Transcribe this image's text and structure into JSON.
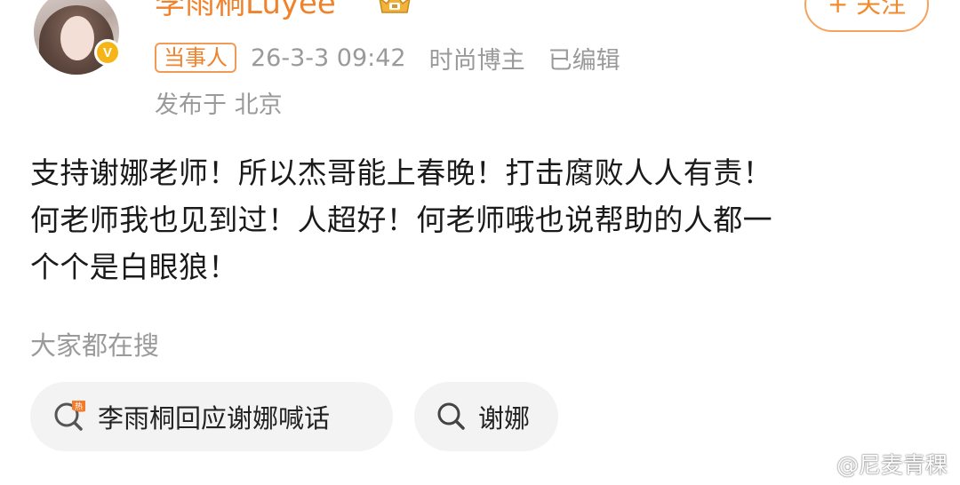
{
  "header": {
    "username": "李雨桐Luyee",
    "follow_label": "+ 关注",
    "party_tag": "当事人",
    "timestamp": "26-3-3 09:42",
    "category": "时尚博主",
    "edited": "已编辑",
    "location": "发布于 北京"
  },
  "post": {
    "lines": [
      "支持谢娜老师！所以杰哥能上春晚！打击腐败人人有责！",
      "何老师我也见到过！人超好！何老师哦也说帮助的人都一",
      "个个是白眼狼！"
    ]
  },
  "search": {
    "section_label": "大家都在搜",
    "chips": [
      {
        "label": "李雨桐回应谢娜喊话",
        "icon": "hot-search-icon"
      },
      {
        "label": "谢娜",
        "icon": "search-icon"
      }
    ]
  },
  "watermark": {
    "text": "@尼麦青稞",
    "icon": "weibo-logo-icon"
  },
  "colors": {
    "accent": "#f0822c",
    "meta": "#9a9a9a",
    "chip_bg": "#f3f3f3",
    "badge": "#f5b516"
  }
}
